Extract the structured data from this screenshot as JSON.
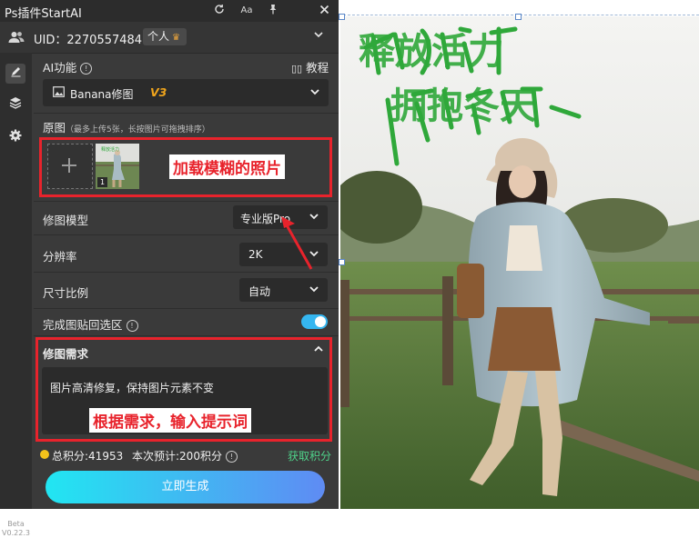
{
  "app": {
    "title": "Ps插件StartAI",
    "version_label": "Beta\nV0.22.3"
  },
  "titlebar": {
    "icons": [
      "refresh-icon",
      "font-size-icon",
      "pin-icon",
      "close-icon"
    ],
    "font_icon_label": "Aa"
  },
  "user": {
    "uid": "UID：2270557484",
    "persona_label": "个人"
  },
  "ai_function": {
    "label": "AI功能",
    "tutorial_label": "教程",
    "model_name": "Banana修图",
    "model_badge": "V3"
  },
  "source": {
    "label": "原图",
    "hint": "（最多上传5张，长按图片可拖拽排序）",
    "thumb_index": "1",
    "annotation": "加载模糊的照片"
  },
  "settings": {
    "model_label": "修图模型",
    "model_value": "专业版Pro",
    "resolution_label": "分辨率",
    "resolution_value": "2K",
    "ratio_label": "尺寸比例",
    "ratio_value": "自动",
    "paste_back_label": "完成图贴回选区",
    "paste_back_enabled": true
  },
  "requirement": {
    "label": "修图需求",
    "prompt_text": "图片高清修复，保持图片元素不变",
    "annotation": "根据需求，输入提示词"
  },
  "footer": {
    "total_points": "总积分:41953",
    "estimate": "本次预计:200积分",
    "get_points": "获取积分",
    "generate_label": "立即生成"
  },
  "canvas": {
    "headline_line1": "释放活力",
    "headline_line2": "拥抱冬天"
  },
  "colors": {
    "accent_gradient_start": "#21e6f2",
    "accent_gradient_end": "#5f8bf3",
    "annotation_red": "#e8232c",
    "get_points_green": "#4fd38a",
    "headline_green": "#2fa83a"
  }
}
